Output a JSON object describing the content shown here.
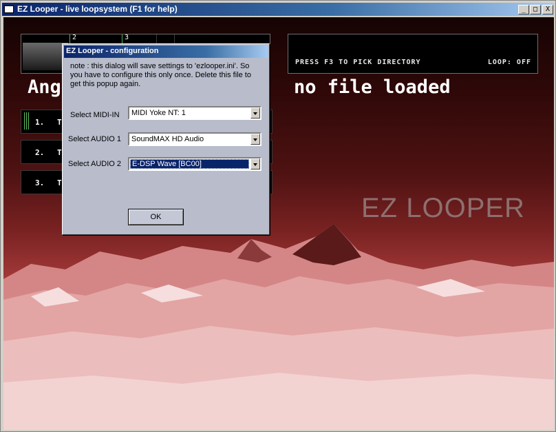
{
  "window": {
    "title": "EZ Looper - live loopsystem (F1 for help)",
    "minimize_glyph": "_",
    "maximize_glyph": "□",
    "close_glyph": "X"
  },
  "main": {
    "wave_markers": [
      "2",
      "3"
    ],
    "directory_hint": "PRESS F3 TO PICK DIRECTORY",
    "loop_status": "LOOP: OFF",
    "song_title": "Ange",
    "file_status": "no file loaded",
    "tracks": [
      {
        "num": "1.",
        "name": "T"
      },
      {
        "num": "2.",
        "name": "T"
      },
      {
        "num": "3.",
        "name": "T"
      }
    ],
    "brand": "EZ LOOPER"
  },
  "dialog": {
    "title": "EZ Looper - configuration",
    "note": "note : this dialog will save settings to 'ezlooper.ini'. So you have to configure this only once. Delete this file to get this popup again.",
    "midi_in_label": "Select MIDI-IN",
    "midi_in_value": "MIDI Yoke NT:  1",
    "audio1_label": "Select AUDIO 1",
    "audio1_value": "SoundMAX HD Audio",
    "audio2_label": "Select AUDIO 2",
    "audio2_value": "E-DSP Wave [BC00]",
    "ok_label": "OK"
  },
  "colors": {
    "titlebar": "#0a246a",
    "marker_green": "#58b058",
    "dialog_bg": "#b8bccb",
    "selection": "#0a246a"
  }
}
